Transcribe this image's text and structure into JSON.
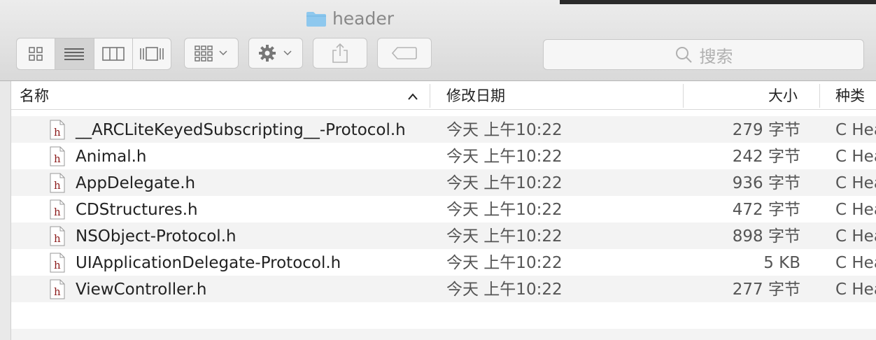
{
  "window": {
    "title": "header"
  },
  "toolbar": {
    "search_placeholder": "搜索"
  },
  "columns": {
    "name": "名称",
    "date": "修改日期",
    "size": "大小",
    "kind": "种类"
  },
  "files": [
    {
      "name": "__ARCLiteKeyedSubscripting__-Protocol.h",
      "date": "今天 上午10:22",
      "size": "279 字节",
      "kind": "C Hea"
    },
    {
      "name": "Animal.h",
      "date": "今天 上午10:22",
      "size": "242 字节",
      "kind": "C Hea"
    },
    {
      "name": "AppDelegate.h",
      "date": "今天 上午10:22",
      "size": "936 字节",
      "kind": "C Hea"
    },
    {
      "name": "CDStructures.h",
      "date": "今天 上午10:22",
      "size": "472 字节",
      "kind": "C Hea"
    },
    {
      "name": "NSObject-Protocol.h",
      "date": "今天 上午10:22",
      "size": "898 字节",
      "kind": "C Hea"
    },
    {
      "name": "UIApplicationDelegate-Protocol.h",
      "date": "今天 上午10:22",
      "size": "5 KB",
      "kind": "C Hea"
    },
    {
      "name": "ViewController.h",
      "date": "今天 上午10:22",
      "size": "277 字节",
      "kind": "C Hea"
    }
  ],
  "icons": {
    "file_letter": "h",
    "file_letter_color": "#8b1a1a",
    "folder_color": "#8ec8ee"
  }
}
